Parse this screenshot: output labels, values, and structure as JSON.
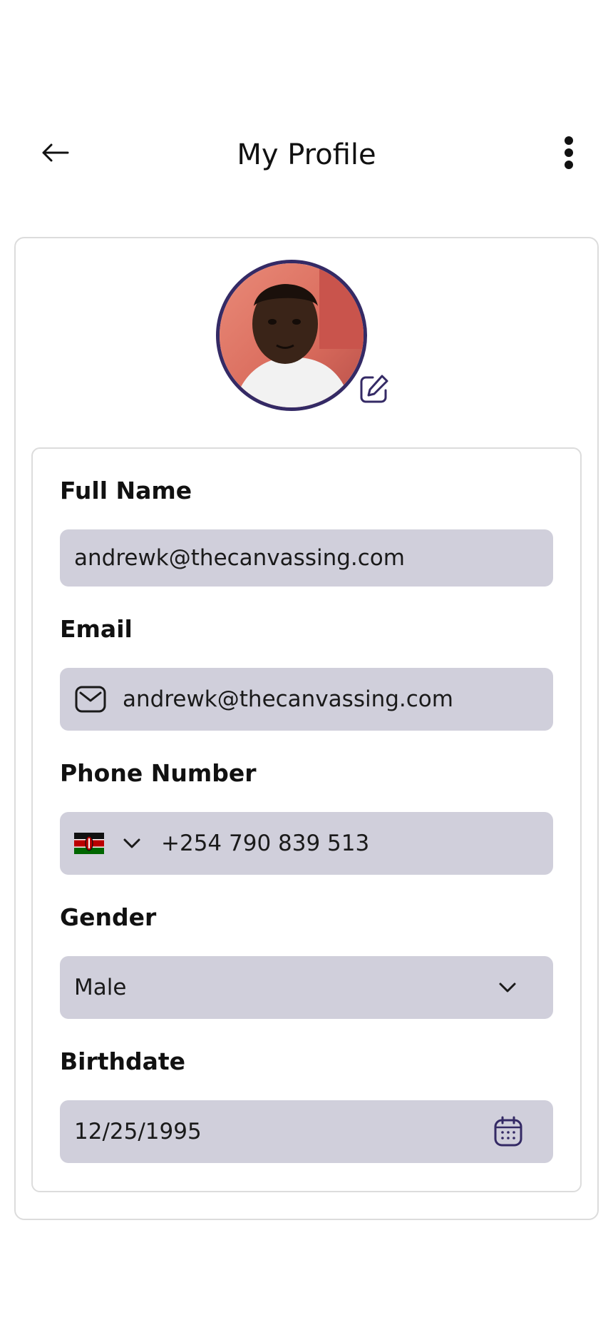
{
  "header": {
    "title": "My Profile",
    "back_icon": "arrow-left-icon",
    "menu_icon": "more-vertical-icon"
  },
  "profile": {
    "avatar_icon": "profile-photo",
    "edit_icon": "edit-pencil-icon"
  },
  "form": {
    "full_name": {
      "label": "Full Name",
      "value": "andrewk@thecanvassing.com"
    },
    "email": {
      "label": "Email",
      "value": "andrewk@thecanvassing.com",
      "icon": "mail-icon"
    },
    "phone": {
      "label": "Phone Number",
      "value": "+254 790 839 513",
      "country_icon": "kenya-flag-icon"
    },
    "gender": {
      "label": "Gender",
      "value": "Male"
    },
    "birthdate": {
      "label": "Birthdate",
      "value": "12/25/1995",
      "icon": "calendar-icon"
    }
  },
  "colors": {
    "accent": "#342a65",
    "field_bg": "#d0cfdb",
    "border": "#dcdcdc"
  }
}
